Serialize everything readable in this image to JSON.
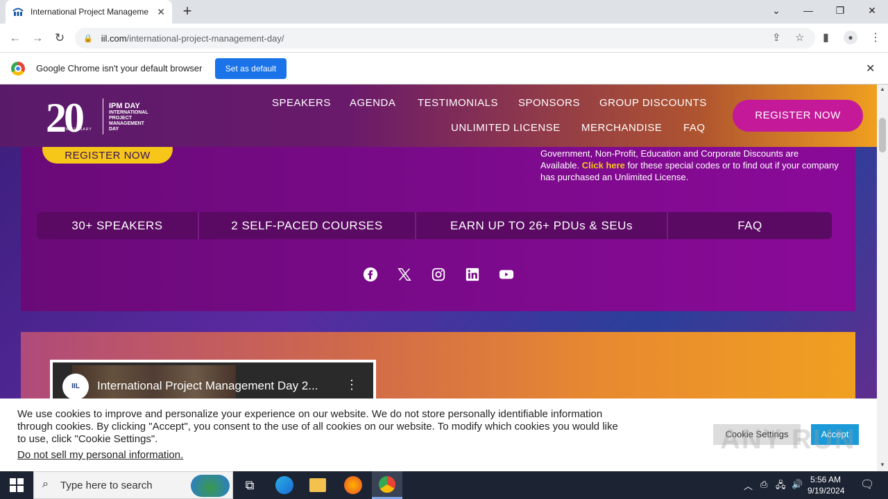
{
  "browser": {
    "tab_title": "International Project Manageme",
    "new_tab": "+",
    "url_domain": "iil.com",
    "url_path": "/international-project-management-day/",
    "window_min": "—",
    "window_restore": "❐",
    "window_close": "✕",
    "tab_list": "⌄"
  },
  "infobar": {
    "message": "Google Chrome isn't your default browser",
    "button": "Set as default",
    "close": "✕"
  },
  "header": {
    "logo_number": "20",
    "logo_tm": "™",
    "logo_sub": "ANNIVERSARY",
    "logo_title": "IPM DAY",
    "logo_lines": [
      "INTERNATIONAL",
      "PROJECT",
      "MANAGEMENT",
      "DAY"
    ],
    "nav": [
      "SPEAKERS",
      "AGENDA",
      "TESTIMONIALS",
      "SPONSORS",
      "GROUP DISCOUNTS",
      "UNLIMITED LICENSE",
      "MERCHANDISE",
      "FAQ"
    ],
    "register_button": "REGISTER NOW"
  },
  "hero": {
    "register_button": "REGISTER NOW",
    "discount_pre": "Government, Non-Profit, Education and Corporate Discounts are Available.",
    "discount_link": "Click here",
    "discount_post": "for these special codes or to find out if your company has purchased an Unlimited License.",
    "stats": [
      "30+ SPEAKERS",
      "2 SELF-PACED COURSES",
      "EARN UP TO 26+ PDUs & SEUs",
      "FAQ"
    ],
    "social": [
      "facebook-icon",
      "x-icon",
      "instagram-icon",
      "linkedin-icon",
      "youtube-icon"
    ]
  },
  "video": {
    "channel": "IIL",
    "title": "International Project Management Day 2...",
    "menu": "⋮"
  },
  "cookie": {
    "text": "We use cookies to improve and personalize your experience on our website. We do not store personally identifiable information through cookies. By clicking \"Accept\", you consent to the use of all cookies on our website. To modify which cookies you would like to use, click \"Cookie Settings\".",
    "dns_link": "Do not sell my personal information.",
    "settings_button": "Cookie Settings",
    "accept_button": "Accept"
  },
  "watermark": "ANY RUN",
  "taskbar": {
    "search_placeholder": "Type here to search",
    "time": "5:56 AM",
    "date": "9/19/2024"
  }
}
